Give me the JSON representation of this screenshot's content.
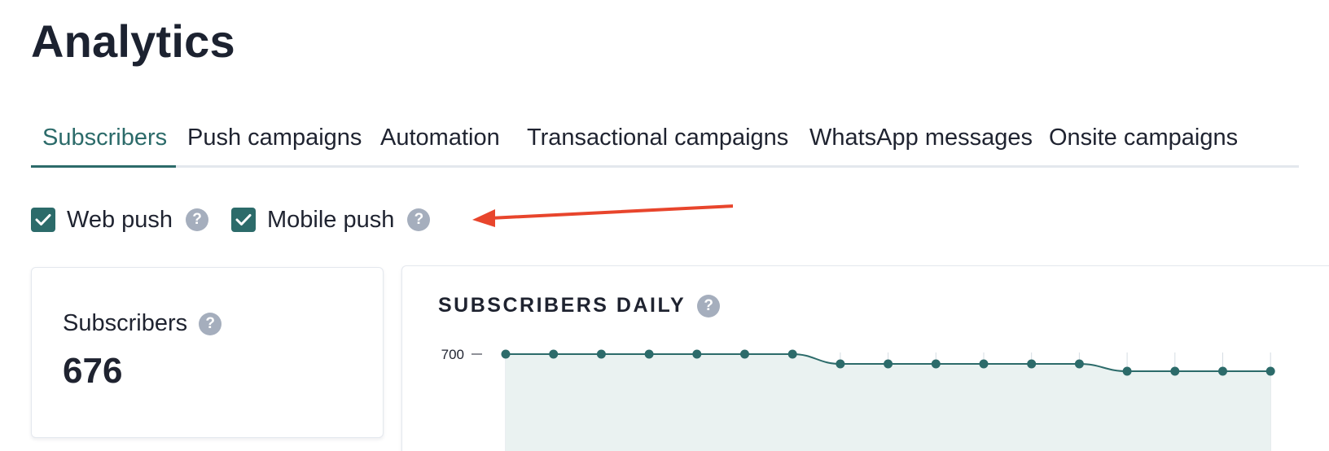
{
  "page": {
    "title": "Analytics"
  },
  "tabs": [
    {
      "label": "Subscribers",
      "active": true
    },
    {
      "label": "Push campaigns",
      "active": false
    },
    {
      "label": "Automation",
      "active": false
    },
    {
      "label": "Transactional campaigns",
      "active": false
    },
    {
      "label": "WhatsApp messages",
      "active": false
    },
    {
      "label": "Onsite campaigns",
      "active": false
    }
  ],
  "filters": {
    "web_push": {
      "label": "Web push",
      "checked": true,
      "help_icon": "question-circle-icon"
    },
    "mobile_push": {
      "label": "Mobile push",
      "checked": true,
      "help_icon": "question-circle-icon"
    }
  },
  "annotation": {
    "icon": "red-arrow-icon",
    "color": "#e8452c"
  },
  "subscribers_card": {
    "label": "Subscribers",
    "value": "676",
    "help_icon": "question-circle-icon"
  },
  "help_glyph": "?",
  "colors": {
    "accent": "#2c6b6a",
    "help_badge": "#a5aebd",
    "area_fill": "#eaf2f1",
    "text": "#1f2330"
  },
  "chart_data": {
    "type": "area",
    "title": "SUBSCRIBERS DAILY",
    "y_ticks": [
      "700"
    ],
    "values": [
      700,
      700,
      700,
      700,
      700,
      700,
      700,
      698,
      698,
      698,
      698,
      698,
      698,
      696.5,
      696.5,
      696.5,
      696.5
    ],
    "grid": true
  }
}
